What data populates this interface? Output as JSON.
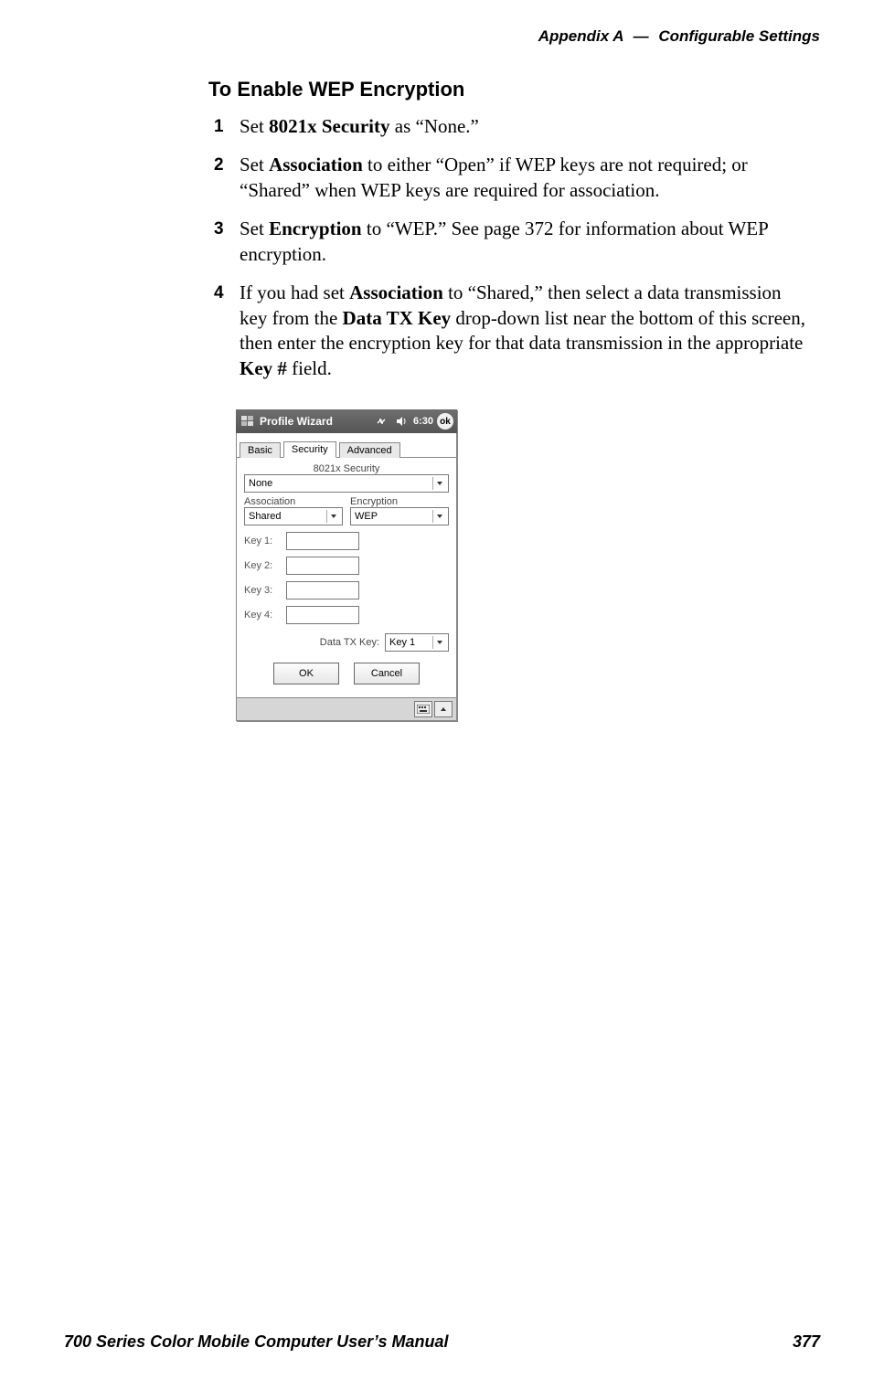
{
  "header": {
    "appendix": "Appendix A",
    "dash": "—",
    "section": "Configurable Settings"
  },
  "title": "To Enable WEP Encryption",
  "steps": [
    {
      "pre": "Set ",
      "b1": "8021x Security",
      "post": " as “None.”"
    },
    {
      "pre": "Set ",
      "b1": "Association",
      "post": " to either “Open” if WEP keys are not required; or “Shared” when WEP keys are required for association."
    },
    {
      "pre": "Set ",
      "b1": "Encryption",
      "post": " to “WEP.” See page 372 for information about WEP encryption."
    },
    {
      "pre": "If you had set ",
      "b1": "Association",
      "mid1": " to “Shared,” then select a data transmission key from the ",
      "b2": "Data TX Key",
      "mid2": " drop-down list near the bottom of this screen, then enter the encryption key for that data transmission in the appropriate ",
      "b3": "Key #",
      "post": " field."
    }
  ],
  "device": {
    "title": "Profile Wizard",
    "time": "6:30",
    "ok": "ok",
    "tabs": {
      "basic": "Basic",
      "security": "Security",
      "advanced": "Advanced"
    },
    "labels": {
      "sec8021x": "8021x Security",
      "association": "Association",
      "encryption": "Encryption",
      "key1": "Key 1:",
      "key2": "Key 2:",
      "key3": "Key 3:",
      "key4": "Key 4:",
      "dataTxKey": "Data TX Key:"
    },
    "values": {
      "sec8021x": "None",
      "association": "Shared",
      "encryption": "WEP",
      "dataTxKey": "Key 1"
    },
    "buttons": {
      "ok": "OK",
      "cancel": "Cancel"
    }
  },
  "footer": {
    "left": "700 Series Color Mobile Computer User’s Manual",
    "right": "377"
  }
}
